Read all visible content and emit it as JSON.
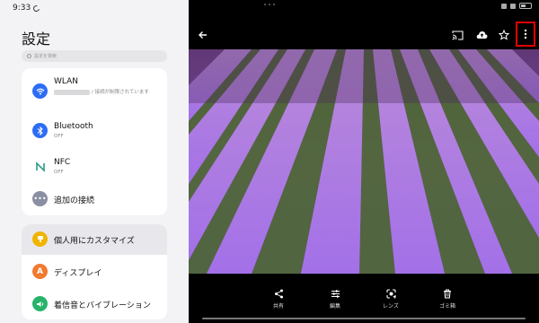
{
  "status": {
    "time": "9:33"
  },
  "settings": {
    "title": "設定",
    "search_placeholder": "設定を検索",
    "items": [
      {
        "label": "WLAN",
        "sub_suffix": "/ 接続が制限されています",
        "color": "#2d6df6"
      },
      {
        "label": "Bluetooth",
        "sub": "OFF",
        "color": "#2d6df6"
      },
      {
        "label": "NFC",
        "sub": "OFF",
        "color": "#2e9a86"
      },
      {
        "label": "追加の接続",
        "color": "#8a8fa3"
      },
      {
        "label": "個人用にカスタマイズ",
        "color": "#f0b400"
      },
      {
        "label": "ディスプレイ",
        "color": "#f07a30"
      },
      {
        "label": "着信音とバイブレーション",
        "color": "#28b36a"
      }
    ]
  },
  "viewer": {
    "toolbar": [
      "back-icon",
      "cast-icon",
      "cloud-upload-icon",
      "star-icon",
      "more-vert-icon"
    ],
    "accent_highlight": "#e00000",
    "bottom_actions": [
      {
        "label": "共有",
        "icon": "share-icon"
      },
      {
        "label": "編集",
        "icon": "edit-sliders-icon"
      },
      {
        "label": "レンズ",
        "icon": "lens-icon"
      },
      {
        "label": "ゴミ箱",
        "icon": "trash-icon"
      }
    ]
  }
}
